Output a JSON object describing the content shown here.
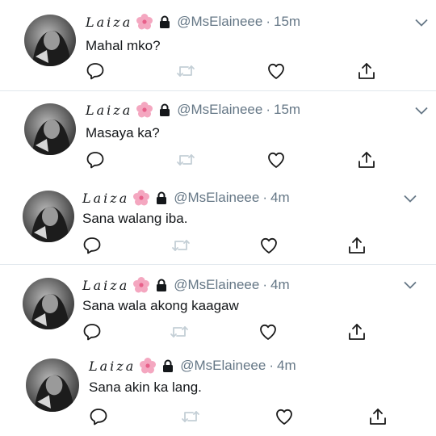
{
  "tweets": [
    {
      "display_name": "Laiza",
      "handle": "@MsElaineee",
      "separator": "·",
      "time": "15m",
      "text": "Mahal mko?"
    },
    {
      "display_name": "Laiza",
      "handle": "@MsElaineee",
      "separator": "·",
      "time": "15m",
      "text": "Masaya ka?"
    },
    {
      "display_name": "Laiza",
      "handle": "@MsElaineee",
      "separator": "·",
      "time": "4m",
      "text": "Sana walang iba."
    },
    {
      "display_name": "Laiza",
      "handle": "@MsElaineee",
      "separator": "·",
      "time": "4m",
      "text": "Sana wala akong kaagaw"
    },
    {
      "display_name": "Laiza",
      "handle": "@MsElaineee",
      "separator": "·",
      "time": "4m",
      "text": "Sana akin ka lang."
    }
  ],
  "icons": {
    "emoji": "cherry-blossom-icon",
    "lock": "lock-icon",
    "menu": "chevron-down-icon",
    "actions": [
      "reply-icon",
      "retweet-icon",
      "like-icon",
      "share-icon"
    ]
  },
  "colors": {
    "text": "#14171a",
    "secondary": "#657786",
    "icon": "#1a1a1a",
    "retweet_disabled": "#c4cfd6",
    "divider": "#e1e8ed",
    "flower": "#f4a7c0"
  }
}
